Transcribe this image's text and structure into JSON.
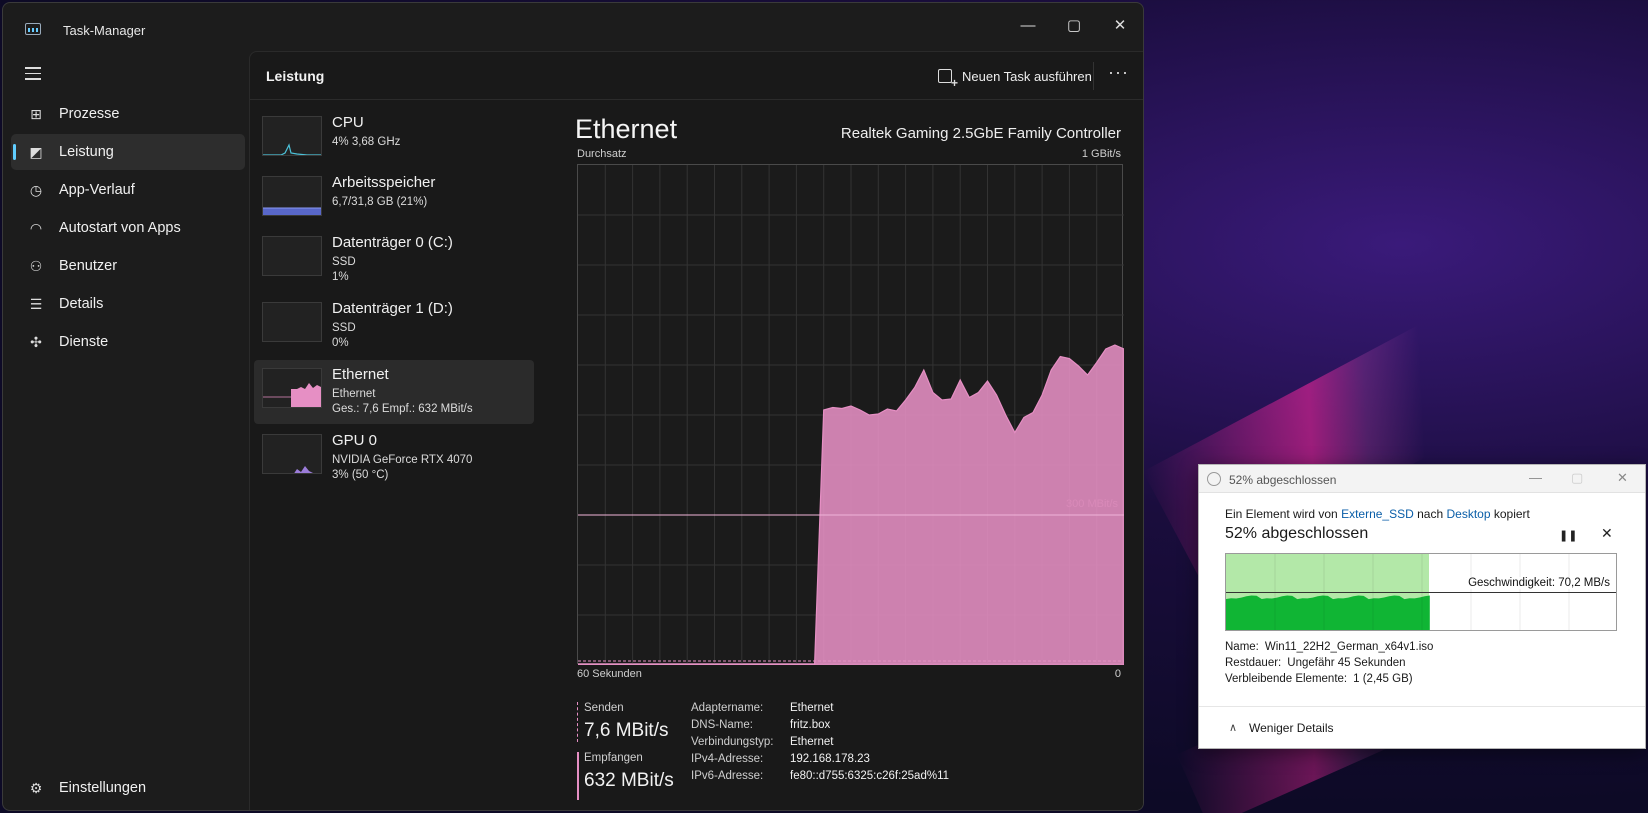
{
  "window": {
    "title": "Task-Manager"
  },
  "sidebar": {
    "items": [
      {
        "label": "Prozesse"
      },
      {
        "label": "Leistung"
      },
      {
        "label": "App-Verlauf"
      },
      {
        "label": "Autostart von Apps"
      },
      {
        "label": "Benutzer"
      },
      {
        "label": "Details"
      },
      {
        "label": "Dienste"
      }
    ],
    "settings": "Einstellungen"
  },
  "header": {
    "title": "Leistung",
    "new_task": "Neuen Task ausführen",
    "more": "···"
  },
  "devices": [
    {
      "name": "CPU",
      "l1": "4% 3,68 GHz",
      "l2": ""
    },
    {
      "name": "Arbeitsspeicher",
      "l1": "6,7/31,8 GB (21%)",
      "l2": ""
    },
    {
      "name": "Datenträger 0 (C:)",
      "l1": "SSD",
      "l2": "1%"
    },
    {
      "name": "Datenträger 1 (D:)",
      "l1": "SSD",
      "l2": "0%"
    },
    {
      "name": "Ethernet",
      "l1": "Ethernet",
      "l2": "Ges.: 7,6 Empf.: 632 MBit/s"
    },
    {
      "name": "GPU 0",
      "l1": "NVIDIA GeForce RTX 4070",
      "l2": "3% (50 °C)"
    }
  ],
  "detail": {
    "title": "Ethernet",
    "adapter_full": "Realtek Gaming 2.5GbE Family Controller",
    "throughput_label": "Durchsatz",
    "max_label": "1 GBit/s",
    "x_left": "60 Sekunden",
    "x_right": "0",
    "ref_label": "300 MBit/s",
    "send_label": "Senden",
    "send_value": "7,6 MBit/s",
    "recv_label": "Empfangen",
    "recv_value": "632 MBit/s",
    "props": [
      {
        "k": "Adaptername:",
        "v": "Ethernet"
      },
      {
        "k": "DNS-Name:",
        "v": "fritz.box"
      },
      {
        "k": "Verbindungstyp:",
        "v": "Ethernet"
      },
      {
        "k": "IPv4-Adresse:",
        "v": "192.168.178.23"
      },
      {
        "k": "IPv6-Adresse:",
        "v": "fe80::d755:6325:c26f:25ad%11"
      }
    ]
  },
  "chart_data": {
    "type": "area",
    "title": "",
    "xlabel": "",
    "ylabel": "Durchsatz",
    "x": [
      60,
      59,
      58,
      57,
      56,
      55,
      54,
      53,
      52,
      51,
      50,
      49,
      48,
      47,
      46,
      45,
      44,
      43,
      42,
      41,
      40,
      39,
      38,
      37,
      36,
      35,
      34,
      33,
      32,
      31,
      30,
      29,
      28,
      27,
      26,
      25,
      24,
      23,
      22,
      21,
      20,
      19,
      18,
      17,
      16,
      15,
      14,
      13,
      12,
      11,
      10,
      9,
      8,
      7,
      6,
      5,
      4,
      3,
      2,
      1,
      0
    ],
    "series": [
      {
        "name": "Empfangen",
        "color": "#e68fc4",
        "values": [
          2,
          2,
          2,
          2,
          2,
          2,
          2,
          2,
          2,
          2,
          2,
          2,
          2,
          2,
          2,
          2,
          2,
          2,
          2,
          2,
          2,
          2,
          2,
          2,
          2,
          2,
          2,
          510,
          515,
          513,
          518,
          510,
          500,
          502,
          512,
          508,
          530,
          555,
          590,
          545,
          530,
          532,
          570,
          535,
          545,
          568,
          540,
          500,
          465,
          495,
          505,
          540,
          590,
          617,
          613,
          598,
          580,
          605,
          632,
          640,
          632
        ]
      },
      {
        "name": "Senden",
        "color": "#e68fc4",
        "values": [
          8,
          8,
          8,
          8,
          8,
          8,
          8,
          8,
          8,
          8,
          8,
          8,
          8,
          8,
          8,
          8,
          8,
          8,
          8,
          8,
          8,
          8,
          8,
          8,
          8,
          8,
          8,
          8,
          8,
          8,
          8,
          8,
          8,
          8,
          8,
          8,
          8,
          8,
          8,
          8,
          8,
          8,
          8,
          8,
          8,
          8,
          8,
          8,
          8,
          8,
          8,
          8,
          8,
          8,
          8,
          8,
          8,
          8,
          8,
          8,
          8
        ]
      }
    ],
    "ylim": [
      0,
      1000
    ],
    "reference_line": 300,
    "grid": true
  },
  "copy_dialog": {
    "title": "52% abgeschlossen",
    "line_prefix": "Ein Element wird von",
    "source": "Externe_SSD",
    "line_mid": "nach",
    "dest": "Desktop",
    "line_suffix": "kopiert",
    "percent_text": "52% abgeschlossen",
    "progress": 0.52,
    "speed": "Geschwindigkeit: 70,2 MB/s",
    "name_k": "Name:",
    "name_v": "Win11_22H2_German_x64v1.iso",
    "rest_k": "Restdauer:",
    "rest_v": "Ungefähr 45 Sekunden",
    "items_k": "Verbleibende Elemente:",
    "items_v": "1 (2,45 GB)",
    "less": "Weniger Details"
  },
  "colors": {
    "accent": "#60cdff",
    "chart_fill": "#e68fc4",
    "progress_green": "#10b534"
  }
}
